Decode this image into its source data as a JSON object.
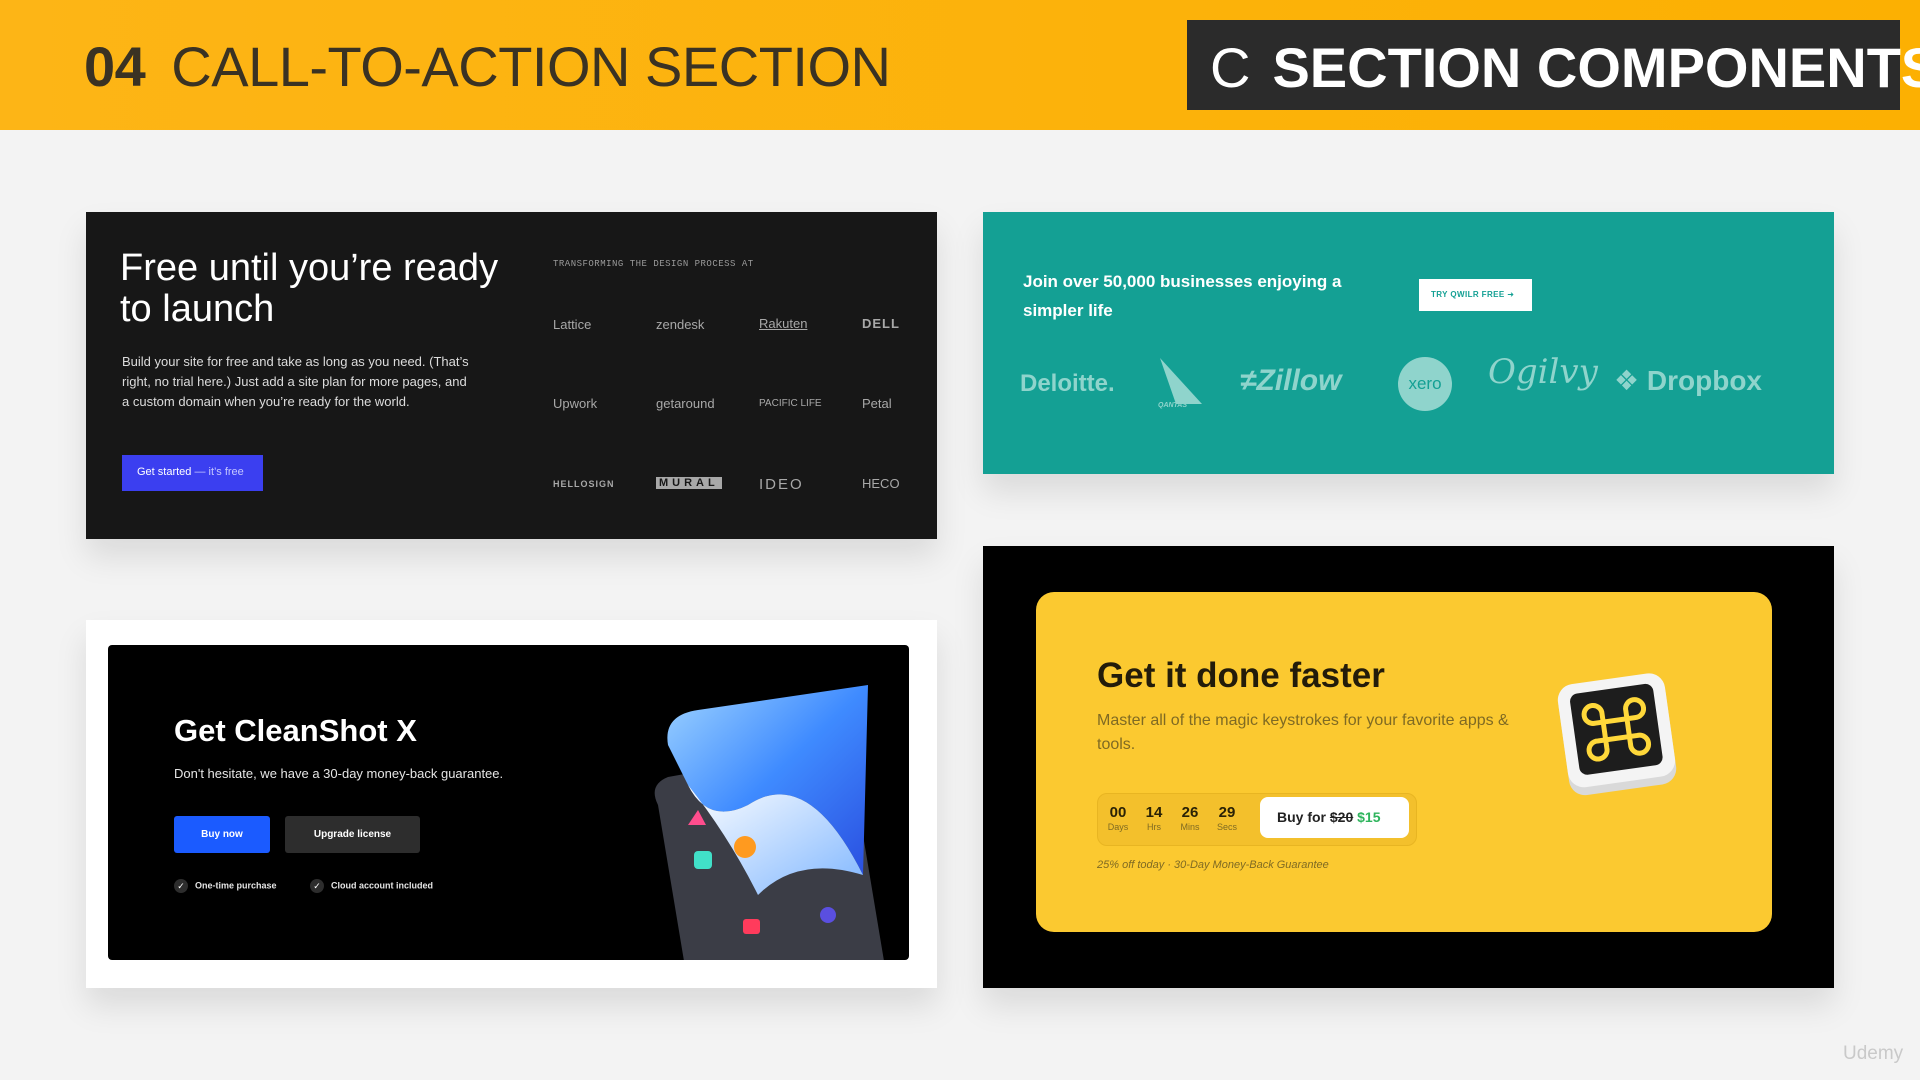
{
  "header": {
    "lesson_number": "04",
    "lesson_title": "CALL-TO-ACTION SECTION",
    "section_letter": "C",
    "section_title": "SECTION COMPONENTS",
    "accent_color": "#fdb516"
  },
  "card_launch": {
    "title": "Free until you’re ready to launch",
    "description": "Build your site for free and take as long as you need. (That’s right, no trial here.) Just add a site plan for more pages, and a custom domain when you’re ready for the world.",
    "button_label": "Get started",
    "button_suffix": "— it’s free",
    "button_color": "#3b3ff0",
    "kicker": "TRANSFORMING THE DESIGN PROCESS AT",
    "logos": [
      "Lattice",
      "zendesk",
      "Rakuten",
      "DELL",
      "Upwork",
      "getaround",
      "PACIFIC LIFE",
      "Petal",
      "HELLOSIGN",
      "MURAL",
      "IDEO",
      "HECO"
    ]
  },
  "card_businesses": {
    "headline": "Join over 50,000 businesses enjoying a simpler life",
    "button_label": "TRY QWILR FREE",
    "background_color": "#14a094",
    "logos": [
      "Deloitte.",
      "QANTAS",
      "Zillow",
      "xero",
      "Ogilvy",
      "Dropbox"
    ]
  },
  "card_cleanshot": {
    "title": "Get CleanShot X",
    "subtitle": "Don't hesitate, we have a 30-day money-back guarantee.",
    "buy_label": "Buy now",
    "upgrade_label": "Upgrade license",
    "features": [
      "One-time purchase",
      "Cloud account included"
    ],
    "buy_color": "#1b5bff"
  },
  "card_faster": {
    "title": "Get it done faster",
    "subtitle": "Master all of the magic keystrokes for your favorite apps & tools.",
    "countdown": [
      {
        "value": "00",
        "label": "Days"
      },
      {
        "value": "14",
        "label": "Hrs"
      },
      {
        "value": "26",
        "label": "Mins"
      },
      {
        "value": "29",
        "label": "Secs"
      }
    ],
    "buy_prefix": "Buy for",
    "old_price": "$20",
    "new_price": "$15",
    "note": "25% off today · 30-Day Money-Back Guarantee",
    "icon": "command-key-icon",
    "background_color": "#fbc930"
  },
  "watermark": "Udemy"
}
